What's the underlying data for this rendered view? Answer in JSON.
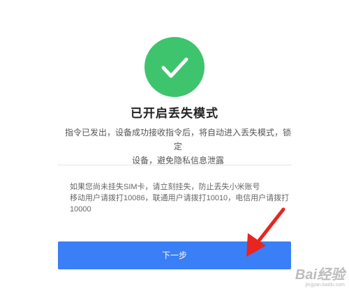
{
  "status": {
    "icon": "checkmark-icon",
    "color": "#3ec46d"
  },
  "title": "已开启丢失模式",
  "description": {
    "line1": "指令已发出，设备成功接收指令后，将自动进入丢失模式，锁定",
    "line2": "设备，避免隐私信息泄露"
  },
  "notice": {
    "line1": "如果您尚未挂失SIM卡，请立刻挂失，防止丢失小米账号",
    "line2": "移动用户请拨打10086，联通用户请拨打10010，电信用户请拨打",
    "line3": "10000"
  },
  "next_button": {
    "label": "下一步",
    "color": "#3b7ff7"
  },
  "annotation": {
    "icon": "red-arrow-icon",
    "color": "#e8251f"
  },
  "watermark": {
    "brand": "Bai经验",
    "domain": "jingyan.baidu.com"
  }
}
